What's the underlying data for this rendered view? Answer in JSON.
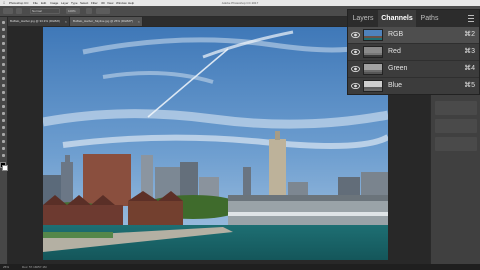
{
  "app": {
    "title": "Adobe Photoshop CC 2017",
    "menu": [
      "Photoshop CC",
      "File",
      "Edit",
      "Image",
      "Layer",
      "Type",
      "Select",
      "Filter",
      "3D",
      "View",
      "Window",
      "Help"
    ]
  },
  "options_bar": {
    "mode": "Normal",
    "opacity": "100%"
  },
  "document_tabs": [
    {
      "label": "Buffalo_Harbor.jpg @ 33.3% (RGB/8)",
      "active": false
    },
    {
      "label": "Buffalo_Harbor_Skyline.jpg @ 25% (RGB/8*)",
      "active": true
    }
  ],
  "panel": {
    "tabs": [
      "Layers",
      "Channels",
      "Paths"
    ],
    "active_tab": "Channels",
    "channels": [
      {
        "name": "RGB",
        "shortcut": "⌘2",
        "selected": true
      },
      {
        "name": "Red",
        "shortcut": "⌘3",
        "selected": false
      },
      {
        "name": "Green",
        "shortcut": "⌘4",
        "selected": false
      },
      {
        "name": "Blue",
        "shortcut": "⌘5",
        "selected": false
      }
    ]
  },
  "status": {
    "zoom": "25%",
    "doc": "Doc: 57.1M/57.1M"
  },
  "colors": {
    "menubar": "#e8e8e8",
    "panel": "#3c3c3c",
    "selected_row": "#4e4e4e",
    "canvas": "#282828"
  }
}
